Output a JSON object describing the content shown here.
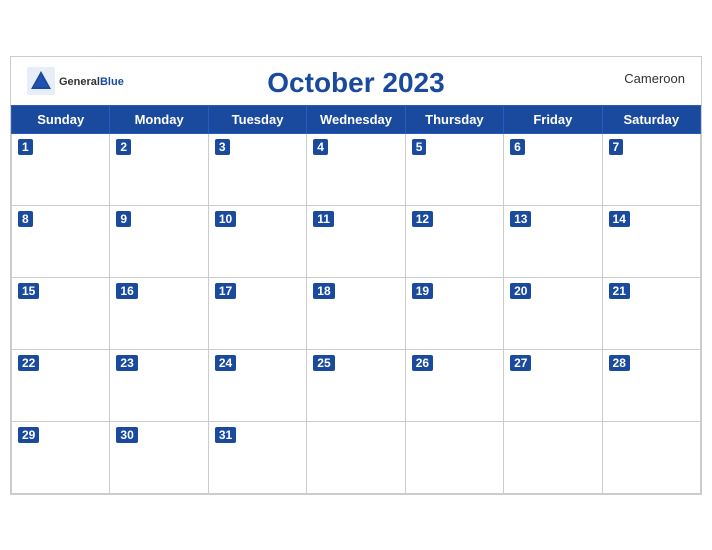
{
  "header": {
    "title": "October 2023",
    "country": "Cameroon",
    "logo_general": "General",
    "logo_blue": "Blue"
  },
  "weekdays": [
    "Sunday",
    "Monday",
    "Tuesday",
    "Wednesday",
    "Thursday",
    "Friday",
    "Saturday"
  ],
  "weeks": [
    [
      1,
      2,
      3,
      4,
      5,
      6,
      7
    ],
    [
      8,
      9,
      10,
      11,
      12,
      13,
      14
    ],
    [
      15,
      16,
      17,
      18,
      19,
      20,
      21
    ],
    [
      22,
      23,
      24,
      25,
      26,
      27,
      28
    ],
    [
      29,
      30,
      31,
      null,
      null,
      null,
      null
    ]
  ]
}
